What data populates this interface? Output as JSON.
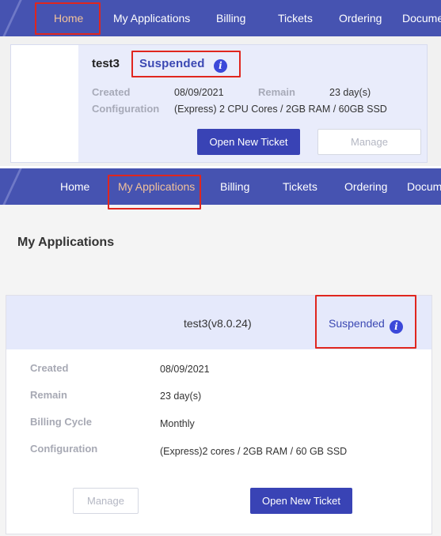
{
  "top_panel": {
    "nav": {
      "items": [
        "Home",
        "My Applications",
        "Billing",
        "Tickets",
        "Ordering",
        "Docume"
      ],
      "active": "Home"
    },
    "app_card": {
      "name": "test3",
      "status": "Suspended",
      "info_symbol": "i",
      "created_label": "Created",
      "created_value": "08/09/2021",
      "remain_label": "Remain",
      "remain_value": "23 day(s)",
      "configuration_label": "Configuration",
      "configuration_value": "(Express) 2 CPU Cores / 2GB RAM / 60GB SSD",
      "open_ticket_label": "Open New Ticket",
      "manage_label": "Manage"
    }
  },
  "bottom_panel": {
    "nav": {
      "items": [
        "Home",
        "My Applications",
        "Billing",
        "Tickets",
        "Ordering",
        "Docum"
      ],
      "active": "My Applications"
    },
    "page_title": "My Applications",
    "app_card": {
      "name": "test3(v8.0.24)",
      "status": "Suspended",
      "info_symbol": "i",
      "details": [
        {
          "label": "Created",
          "value": "08/09/2021"
        },
        {
          "label": "Remain",
          "value": "23 day(s)"
        },
        {
          "label": "Billing Cycle",
          "value": "Monthly"
        },
        {
          "label": "Configuration",
          "value": "(Express)2 cores / 2GB RAM / 60 GB SSD"
        }
      ],
      "manage_label": "Manage",
      "open_ticket_label": "Open New Ticket"
    }
  },
  "colors": {
    "nav_bg": "#4653b1",
    "accent": "#3943b5",
    "highlight": "#e0261e",
    "active_nav_text": "#f2c29a"
  },
  "icons": [
    "info-icon",
    "logo-slash-icon"
  ]
}
